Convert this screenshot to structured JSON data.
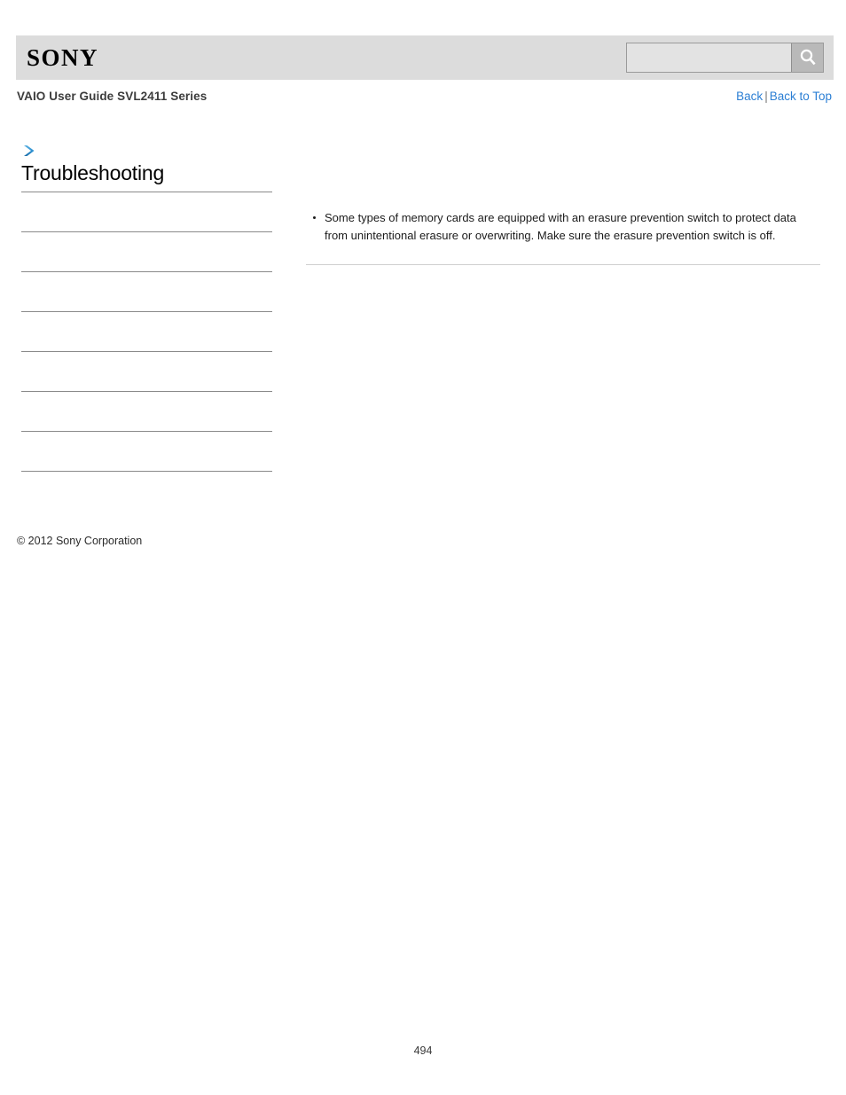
{
  "header": {
    "logo_text": "SONY",
    "logo_icon": "sony-wordmark",
    "search": {
      "value": "",
      "placeholder": "",
      "button_icon": "search-icon"
    }
  },
  "subheader": {
    "guide_title": "VAIO User Guide SVL2411 Series",
    "links": {
      "back": "Back",
      "separator": "|",
      "back_to_top": "Back to Top"
    }
  },
  "sidebar": {
    "breadcrumb_icon": "chevron-right-icon",
    "section_title": "Troubleshooting",
    "items": [
      {
        "label": ""
      },
      {
        "label": ""
      },
      {
        "label": ""
      },
      {
        "label": ""
      },
      {
        "label": ""
      },
      {
        "label": ""
      },
      {
        "label": ""
      }
    ]
  },
  "footer": {
    "copyright": "© 2012 Sony Corporation",
    "page_number": "494"
  },
  "main": {
    "bullets": [
      "Some types of memory cards are equipped with an erasure prevention switch to protect data from unintentional erasure or overwriting. Make sure the erasure prevention switch is off."
    ]
  },
  "colors": {
    "header_band": "#dcdcdc",
    "link_blue": "#2c7fd4",
    "arrow_blue": "#2b8fd0",
    "rule_gray": "#8a8a8a",
    "content_rule_gray": "#cfcfcf"
  }
}
